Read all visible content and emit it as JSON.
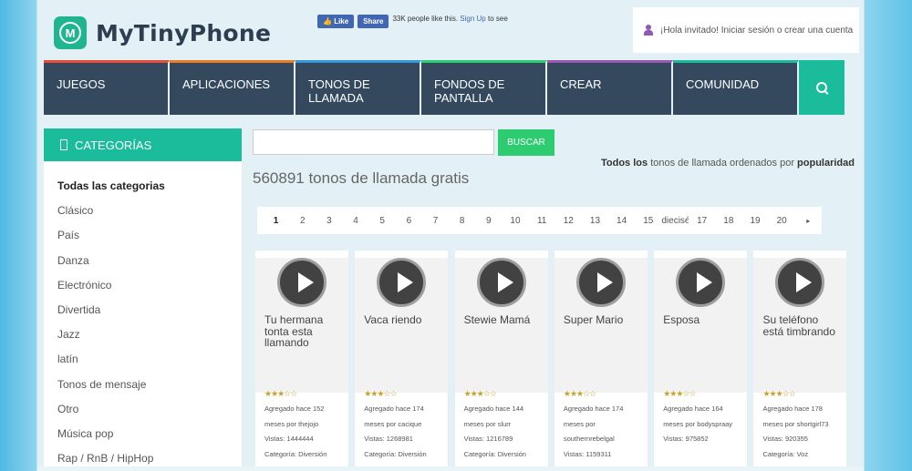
{
  "brand": {
    "logo_letter": "M",
    "name": "MyTinyPhone",
    "accent": "#1abc9c"
  },
  "facebook": {
    "like_label": "Like",
    "share_label": "Share",
    "count_text": "33K people like this.",
    "signup_link": "Sign Up",
    "signup_rest": "to see"
  },
  "login": {
    "text": "¡Hola invitado! Iniciar sesión o crear una cuenta"
  },
  "nav": {
    "items": [
      {
        "label": "JUEGOS",
        "color": "#e74c3c"
      },
      {
        "label": "APLICACIONES",
        "color": "#e67e22"
      },
      {
        "label": "TONOS DE LLAMADA",
        "color": "#3498db"
      },
      {
        "label": "FONDOS DE PANTALLA",
        "color": "#2ecc71"
      },
      {
        "label": "CREAR",
        "color": "#9b59b6"
      },
      {
        "label": "COMUNIDAD",
        "color": "#1abc9c"
      }
    ],
    "search_icon": "search-icon"
  },
  "sidebar": {
    "title": "CATEGORÍAS",
    "categories": [
      "Todas las categorias",
      "Clásico",
      "País",
      "Danza",
      "Electrónico",
      "Divertida",
      "Jazz",
      "latín",
      "Tonos de mensaje",
      "Otro",
      "Música pop",
      "Rap / RnB / HipHop"
    ]
  },
  "search": {
    "placeholder": "",
    "button_label": "BUSCAR"
  },
  "sort_note": {
    "bold1": "Todos los",
    "middle": "tonos de llamada ordenados por",
    "bold2": "popularidad"
  },
  "count_title": "560891 tonos de llamada gratis",
  "pager": {
    "pages": [
      "1",
      "2",
      "3",
      "4",
      "5",
      "6",
      "7",
      "8",
      "9",
      "10",
      "11",
      "12",
      "13",
      "14",
      "15",
      "dieciséis",
      "17",
      "18",
      "19",
      "20"
    ],
    "active": "1",
    "next": "▸"
  },
  "ringtones": [
    {
      "title": "Tu hermana tonta esta llamando",
      "stars": "★★★☆☆",
      "added": "Agregado hace 152 meses por thejojo",
      "views": "Vistas: 1444444",
      "category": "Categoría: Diversión"
    },
    {
      "title": "Vaca riendo",
      "stars": "★★★☆☆",
      "added": "Agregado hace 174 meses por cacique",
      "views": "Vistas: 1268981",
      "category": "Categoría: Diversión"
    },
    {
      "title": "Stewie Mamá",
      "stars": "★★★☆☆",
      "added": "Agregado hace 144 meses por slurr",
      "views": "Vistas: 1216789",
      "category": "Categoría: Diversión"
    },
    {
      "title": "Super Mario",
      "stars": "★★★☆☆",
      "added": "Agregado hace 174 meses por southernrebelgal",
      "views": "Vistas: 1159311",
      "category": ""
    },
    {
      "title": "Esposa",
      "stars": "★★★☆☆",
      "added": "Agregado hace 164 meses por bodyspraay",
      "views": "Vistas: 975852",
      "category": ""
    },
    {
      "title": "Su teléfono está timbrando",
      "stars": "★★★☆☆",
      "added": "Agregado hace 178 meses por shortgirl73",
      "views": "Vistas: 920355",
      "category": "Categoría: Voz"
    }
  ]
}
